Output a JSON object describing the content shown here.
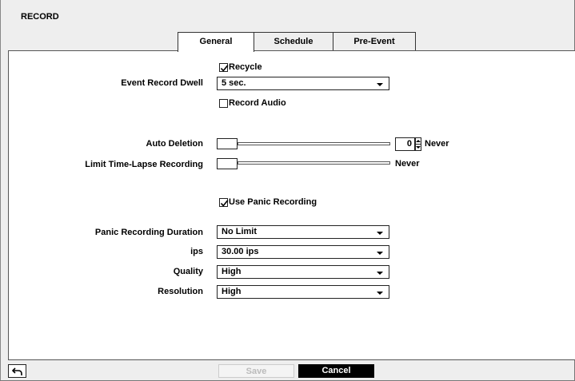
{
  "window": {
    "title": "RECORD"
  },
  "tabs": [
    {
      "label": "General",
      "active": true
    },
    {
      "label": "Schedule",
      "active": false
    },
    {
      "label": "Pre-Event",
      "active": false
    }
  ],
  "general": {
    "recycle": {
      "label": "Recycle",
      "checked": true
    },
    "event_record_dwell": {
      "label": "Event Record Dwell",
      "value": "5 sec."
    },
    "record_audio": {
      "label": "Record Audio",
      "checked": false
    },
    "auto_deletion": {
      "label": "Auto Deletion",
      "value": "0",
      "suffix": "Never",
      "slider_fraction": 0
    },
    "limit_time_lapse": {
      "label": "Limit Time-Lapse Recording",
      "suffix": "Never",
      "slider_fraction": 0
    },
    "use_panic": {
      "label": "Use Panic Recording",
      "checked": true
    }
  },
  "panic": {
    "duration": {
      "label": "Panic Recording Duration",
      "value": "No Limit"
    },
    "ips": {
      "label": "ips",
      "value": "30.00 ips"
    },
    "quality": {
      "label": "Quality",
      "value": "High"
    },
    "resolution": {
      "label": "Resolution",
      "value": "High"
    }
  },
  "footer": {
    "save_label": "Save",
    "cancel_label": "Cancel",
    "back_icon": "back-arrow-icon"
  }
}
